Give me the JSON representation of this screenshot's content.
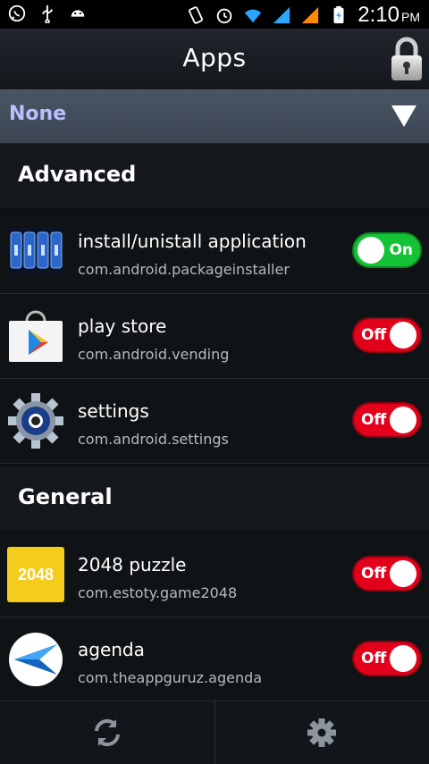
{
  "status_bar": {
    "time": "2:10",
    "ampm": "PM"
  },
  "header": {
    "title": "Apps",
    "lock_icon": "lock-icon"
  },
  "filter": {
    "selected": "None"
  },
  "sections": [
    {
      "label": "Advanced",
      "apps": [
        {
          "name": "install/unistall application",
          "package": "com.android.packageinstaller",
          "state": "On"
        },
        {
          "name": "play store",
          "package": "com.android.vending",
          "state": "Off"
        },
        {
          "name": "settings",
          "package": "com.android.settings",
          "state": "Off"
        }
      ]
    },
    {
      "label": "General",
      "apps": [
        {
          "name": "2048 puzzle",
          "package": "com.estoty.game2048",
          "state": "Off",
          "icon_text": "2048"
        },
        {
          "name": "agenda",
          "package": "com.theappguruz.agenda",
          "state": "Off"
        }
      ]
    }
  ],
  "colors": {
    "on": "#15c235",
    "off": "#e3001b",
    "filter_text": "#b8c1ff"
  },
  "bottom_bar": {
    "left_icon": "refresh-icon",
    "right_icon": "gear-icon"
  }
}
